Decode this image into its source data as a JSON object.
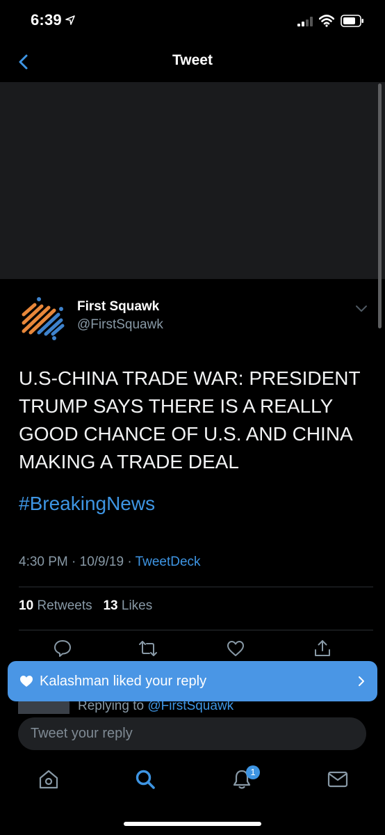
{
  "status_bar": {
    "time": "6:39"
  },
  "nav": {
    "title": "Tweet"
  },
  "tweet": {
    "author_name": "First Squawk",
    "author_handle": "@FirstSquawk",
    "text": "U.S-CHINA TRADE WAR: PRESIDENT TRUMP SAYS THERE IS A REALLY GOOD CHANCE OF U.S. AND CHINA MAKING A TRADE DEAL",
    "hashtag": "#BreakingNews",
    "timestamp": "4:30 PM · 10/9/19 · ",
    "source": "TweetDeck",
    "retweets_count": "10",
    "retweets_label": "Retweets",
    "likes_count": "13",
    "likes_label": "Likes"
  },
  "reply_peek": {
    "prefix": "Replying to ",
    "mention": "@FirstSquawk"
  },
  "toast": {
    "text": "Kalashman liked your reply"
  },
  "reply_input": {
    "placeholder": "Tweet your reply"
  },
  "tabbar": {
    "notification_badge": "1"
  },
  "colors": {
    "accent": "#3e95e3",
    "toast": "#4a96e5",
    "background": "#000000",
    "secondary_text": "#8899a6"
  }
}
